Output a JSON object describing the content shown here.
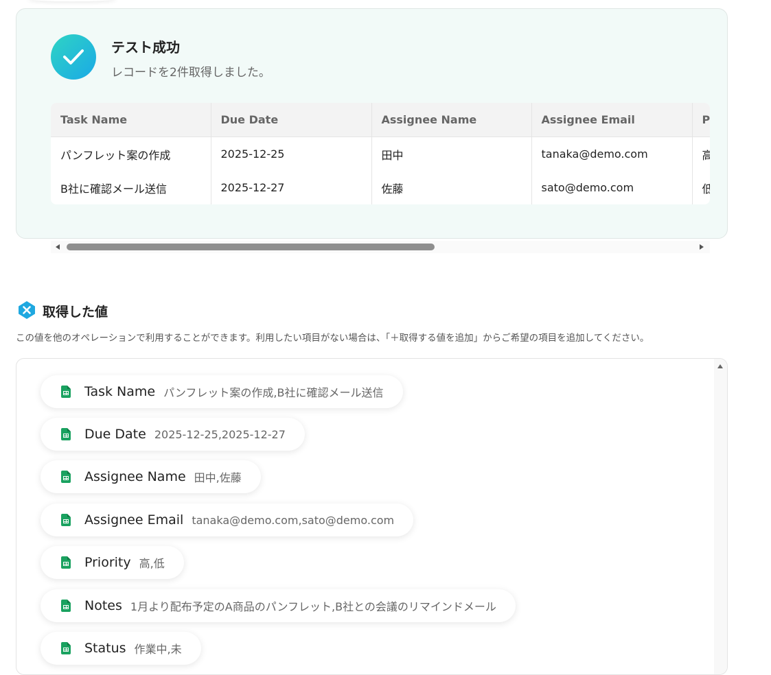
{
  "test_result": {
    "title": "テスト成功",
    "subtitle": "レコードを2件取得しました。"
  },
  "table": {
    "columns": [
      "Task Name",
      "Due Date",
      "Assignee Name",
      "Assignee Email",
      "P"
    ],
    "rows": [
      [
        "パンフレット案の作成",
        "2025-12-25",
        "田中",
        "tanaka@demo.com",
        "高"
      ],
      [
        "B社に確認メール送信",
        "2025-12-27",
        "佐藤",
        "sato@demo.com",
        "低"
      ]
    ]
  },
  "retrieved": {
    "title": "取得した値",
    "description": "この値を他のオペレーションで利用することができます。利用したい項目がない場合は、「＋取得する値を追加」からご希望の項目を追加してください。",
    "items": [
      {
        "name": "Task Name",
        "value": "パンフレット案の作成,B社に確認メール送信"
      },
      {
        "name": "Due Date",
        "value": "2025-12-25,2025-12-27"
      },
      {
        "name": "Assignee Name",
        "value": "田中,佐藤"
      },
      {
        "name": "Assignee Email",
        "value": "tanaka@demo.com,sato@demo.com"
      },
      {
        "name": "Priority",
        "value": "高,低"
      },
      {
        "name": "Notes",
        "value": "1月より配布予定のA商品のパンフレット,B社との会議のリマインドメール"
      },
      {
        "name": "Status",
        "value": "作業中,未"
      }
    ]
  },
  "colors": {
    "success_gradient_start": "#2fd4c4",
    "success_gradient_end": "#1aa9e6",
    "sheet_icon_green": "#1aa260",
    "section_icon_blue": "#1fa8e0"
  }
}
